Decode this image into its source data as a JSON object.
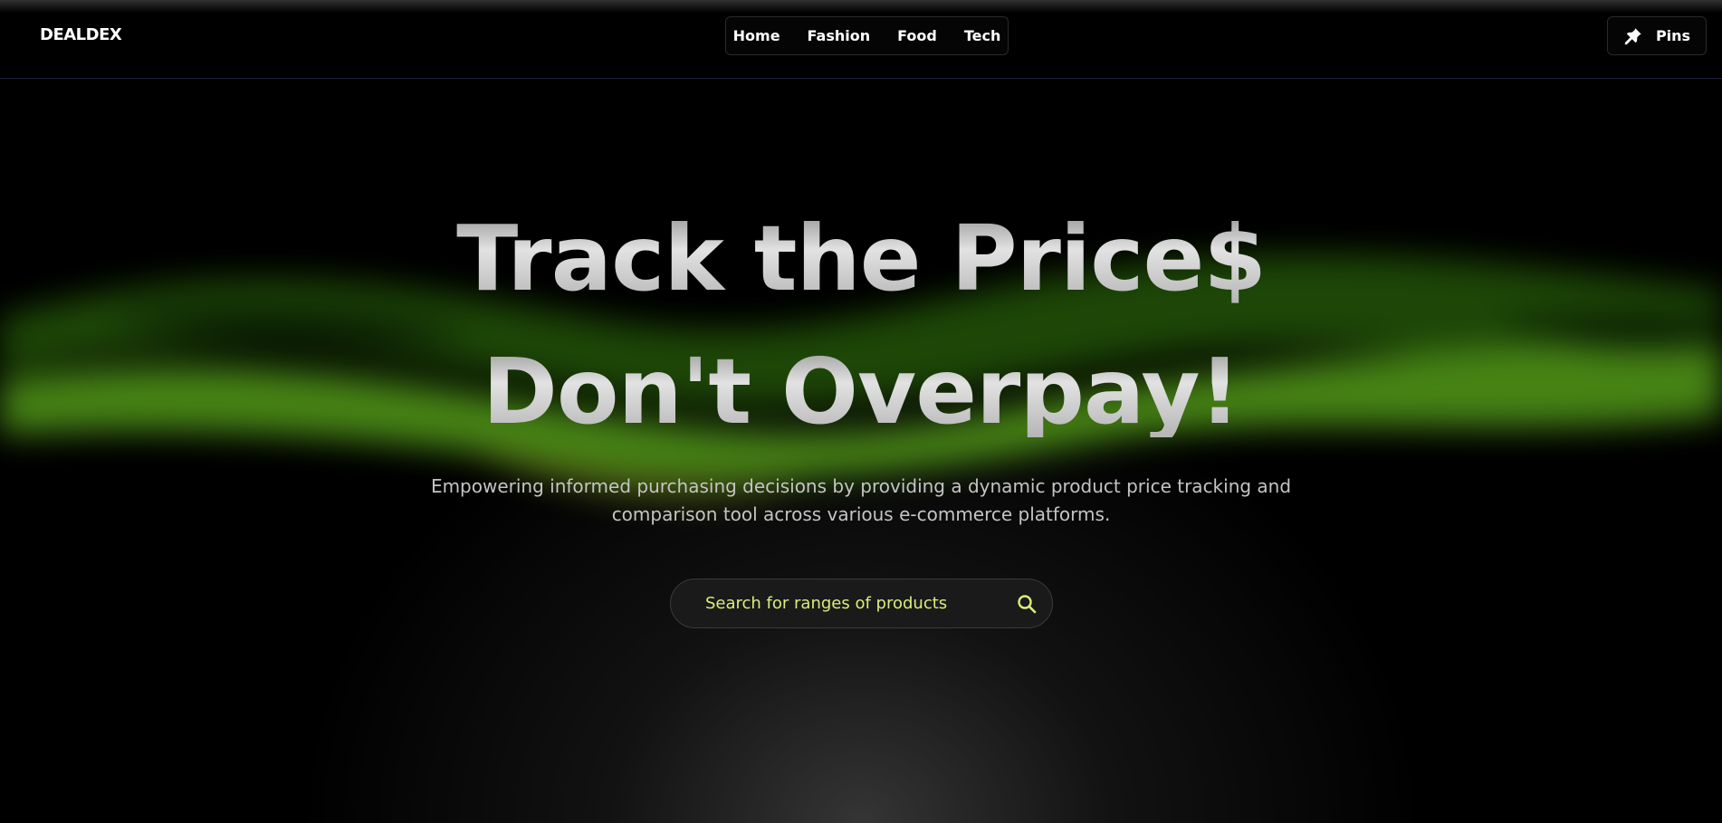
{
  "header": {
    "logo": "DEALDEX",
    "nav": [
      {
        "label": "Home"
      },
      {
        "label": "Fashion"
      },
      {
        "label": "Food"
      },
      {
        "label": "Tech"
      }
    ],
    "pins_button": {
      "label": "Pins",
      "icon": "pin-icon"
    }
  },
  "hero": {
    "line1": "Track the Price$",
    "line2": "Don't Overpay!",
    "subtitle": "Empowering informed purchasing decisions by providing a dynamic product price tracking and comparison tool across various e-commerce platforms."
  },
  "search": {
    "placeholder": "Search for ranges of products",
    "value": "",
    "icon": "search-icon"
  },
  "colors": {
    "background": "#000000",
    "accent_green": "#4a8a12",
    "search_text": "#d8ef7a"
  }
}
